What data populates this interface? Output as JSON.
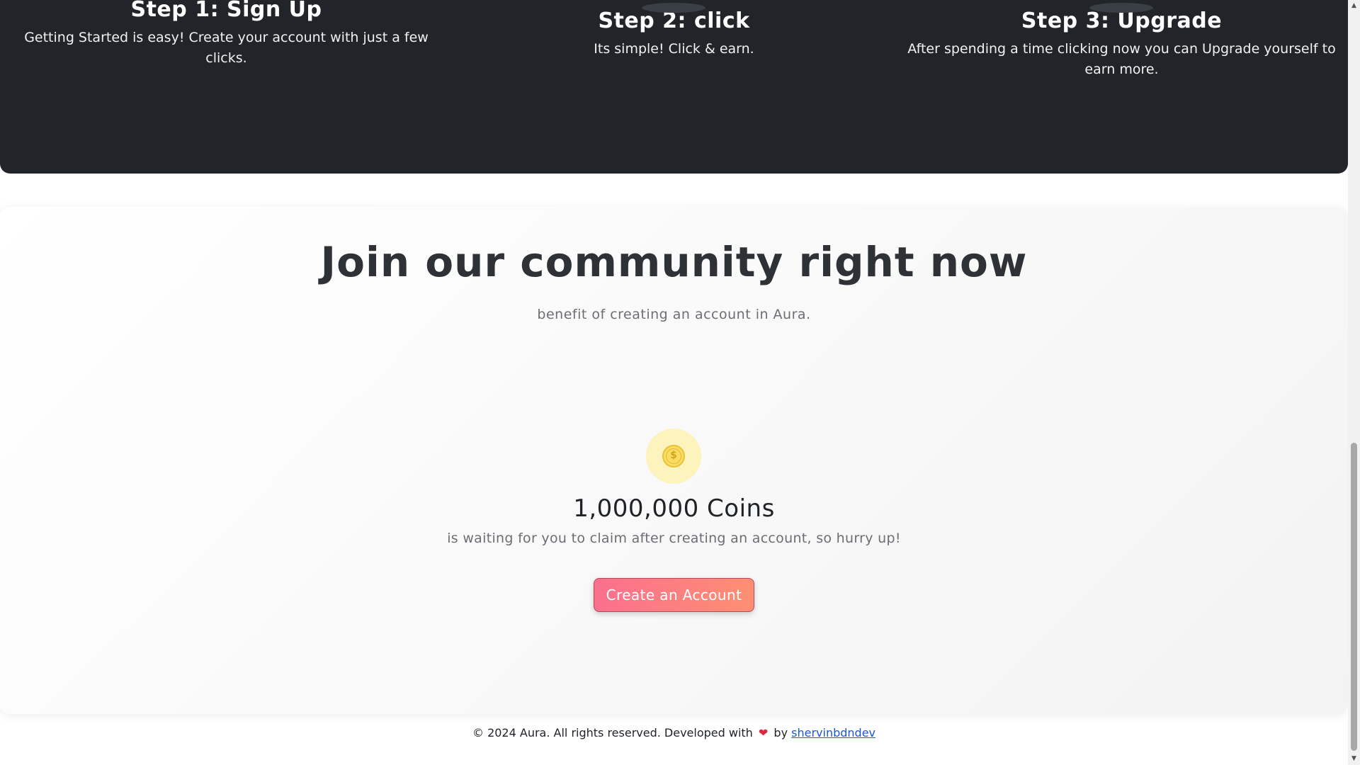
{
  "steps": [
    {
      "title": "Step 1: Sign Up",
      "description": "Getting Started is easy! Create your account with just a few clicks."
    },
    {
      "title": "Step 2: click",
      "description": "Its simple! Click & earn."
    },
    {
      "title": "Step 3: Upgrade",
      "description": "After spending a time clicking now you can Upgrade yourself to earn more."
    }
  ],
  "community": {
    "title": "Join our community right now",
    "subtitle": "benefit of creating an account in Aura.",
    "coin_symbol": "$",
    "coins_amount": "1,000,000 Coins",
    "coins_desc": "is waiting for you to claim after creating an account, so hurry up!",
    "cta_label": "Create an Account"
  },
  "footer": {
    "text": "© 2024 Aura. All rights reserved. Developed with",
    "heart": "❤",
    "by": "by",
    "author": "shervinbdndev"
  },
  "scrollbar": {
    "up": "▲",
    "down": "▼"
  },
  "colors": {
    "dark_band": "#212429",
    "cta_start": "#fb6f8e",
    "cta_end": "#fd8f72",
    "coin_bg": "#fdf3bd",
    "link": "#1a56d6"
  }
}
